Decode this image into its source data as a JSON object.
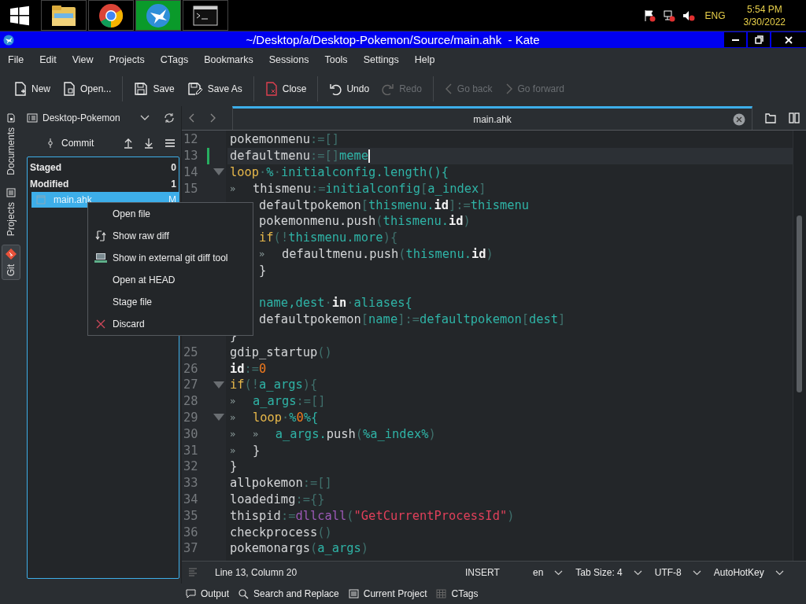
{
  "taskbar": {
    "apps": [
      {
        "kind": "explorer",
        "selected": false
      },
      {
        "kind": "chrome",
        "selected": false
      },
      {
        "kind": "kate",
        "selected": true
      },
      {
        "kind": "terminal",
        "selected": false
      }
    ],
    "tray": {
      "language": "ENG",
      "time": "5:54 PM",
      "date": "3/30/2022"
    }
  },
  "window": {
    "title": "~/Desktop/a/Desktop-Pokemon/Source/main.ahk  - Kate"
  },
  "menu": [
    "File",
    "Edit",
    "View",
    "Projects",
    "CTags",
    "Bookmarks",
    "Sessions",
    "Tools",
    "Settings",
    "Help"
  ],
  "toolbar": [
    {
      "label": "New",
      "kind": "new",
      "disabled": false
    },
    {
      "label": "Open...",
      "kind": "open",
      "disabled": false
    },
    {
      "label": "Save",
      "kind": "save",
      "disabled": false,
      "separator": true
    },
    {
      "label": "Save As",
      "kind": "saveas",
      "disabled": false
    },
    {
      "label": "Close",
      "kind": "close",
      "disabled": false,
      "separator": true
    },
    {
      "label": "Undo",
      "kind": "undo",
      "disabled": false,
      "separator": true
    },
    {
      "label": "Redo",
      "kind": "redo",
      "disabled": true
    },
    {
      "label": "Go back",
      "kind": "back",
      "disabled": true,
      "separator": true
    },
    {
      "label": "Go forward",
      "kind": "forward",
      "disabled": true
    }
  ],
  "side_tabs": [
    {
      "label": "Documents",
      "kind": "documents",
      "selected": false
    },
    {
      "label": "Projects",
      "kind": "projects",
      "selected": false
    },
    {
      "label": "Git",
      "kind": "git",
      "selected": true
    }
  ],
  "git_panel": {
    "project": "Desktop-Pokemon",
    "commit": "Commit",
    "sections": [
      {
        "label": "Staged",
        "count": "0"
      },
      {
        "label": "Modified",
        "count": "1",
        "files": [
          {
            "name": "main.ahk",
            "status": "M",
            "selected": true
          }
        ]
      }
    ]
  },
  "editor": {
    "tabs": [
      {
        "label": "main.ahk",
        "selected": true
      }
    ],
    "lines": [
      {
        "number": "12",
        "tokens": [
          {
            "kind": "plain",
            "text": "pokemonmenu"
          },
          {
            "kind": "op",
            "text": ":=[]"
          }
        ]
      },
      {
        "number": "13",
        "current": true,
        "modified": true,
        "cursor": true,
        "tokens": [
          {
            "kind": "plain",
            "text": "defaultmenu"
          },
          {
            "kind": "op",
            "text": ":=[]"
          },
          {
            "kind": "var",
            "text": "meme"
          }
        ]
      },
      {
        "number": "14",
        "fold": true,
        "tokens": [
          {
            "kind": "keyword",
            "text": "loop"
          },
          {
            "kind": "op",
            "text": "·"
          },
          {
            "kind": "var",
            "text": "%"
          },
          {
            "kind": "op",
            "text": "·"
          },
          {
            "kind": "var",
            "text": "initialconfig.length(){"
          }
        ]
      },
      {
        "number": "15",
        "marks": "»",
        "tokens": [
          {
            "kind": "plain",
            "text": "thismenu"
          },
          {
            "kind": "op",
            "text": ":="
          },
          {
            "kind": "var",
            "text": "initialconfig"
          },
          {
            "kind": "op",
            "text": "["
          },
          {
            "kind": "var",
            "text": "a_index"
          },
          {
            "kind": "op",
            "text": "]"
          }
        ]
      },
      {
        "covered": true,
        "tokens": [
          {
            "kind": "plain",
            "text": "defaultpokemon"
          },
          {
            "kind": "op",
            "text": "["
          },
          {
            "kind": "var",
            "text": "thismenu."
          },
          {
            "kind": "bold",
            "text": "id"
          },
          {
            "kind": "op",
            "text": "]:="
          },
          {
            "kind": "var",
            "text": "thismenu"
          }
        ]
      },
      {
        "covered": true,
        "tokens": [
          {
            "kind": "plain",
            "text": "pokemonmenu.push"
          },
          {
            "kind": "op",
            "text": "("
          },
          {
            "kind": "var",
            "text": "thismenu."
          },
          {
            "kind": "bold",
            "text": "id"
          },
          {
            "kind": "op",
            "text": ")"
          }
        ]
      },
      {
        "covered": true,
        "tokens": [
          {
            "kind": "keyword",
            "text": "if"
          },
          {
            "kind": "op",
            "text": "(!"
          },
          {
            "kind": "var",
            "text": "thismenu.more"
          },
          {
            "kind": "op",
            "text": "){"
          }
        ]
      },
      {
        "covered": true,
        "marks": "»",
        "tokens": [
          {
            "kind": "plain",
            "text": "defaultmenu.push"
          },
          {
            "kind": "op",
            "text": "("
          },
          {
            "kind": "var",
            "text": "thismenu."
          },
          {
            "kind": "bold",
            "text": "id"
          },
          {
            "kind": "op",
            "text": ")"
          }
        ]
      },
      {
        "covered": true,
        "tokens": [
          {
            "kind": "plain",
            "text": "}"
          }
        ]
      },
      {
        "covered": true
      },
      {
        "covered": true,
        "tokens": [
          {
            "kind": "var",
            "text": "name,dest"
          },
          {
            "kind": "op",
            "text": "·"
          },
          {
            "kind": "bold",
            "text": "in"
          },
          {
            "kind": "op",
            "text": "·"
          },
          {
            "kind": "var",
            "text": "aliases{"
          }
        ]
      },
      {
        "covered": true,
        "tokens": [
          {
            "kind": "plain",
            "text": "defaultpokemon"
          },
          {
            "kind": "op",
            "text": "["
          },
          {
            "kind": "var",
            "text": "name"
          },
          {
            "kind": "op",
            "text": "]:="
          },
          {
            "kind": "var",
            "text": "defaultpokemon"
          },
          {
            "kind": "op",
            "text": "["
          },
          {
            "kind": "var",
            "text": "dest"
          },
          {
            "kind": "op",
            "text": "]"
          }
        ]
      },
      {
        "tokens": [
          {
            "kind": "plain",
            "text": "}"
          }
        ]
      },
      {
        "number": "25",
        "tokens": [
          {
            "kind": "plain",
            "text": "gdip_startup"
          },
          {
            "kind": "op",
            "text": "()"
          }
        ]
      },
      {
        "number": "26",
        "tokens": [
          {
            "kind": "bold",
            "text": "id"
          },
          {
            "kind": "op",
            "text": ":="
          },
          {
            "kind": "number",
            "text": "0"
          }
        ]
      },
      {
        "number": "27",
        "fold": true,
        "tokens": [
          {
            "kind": "keyword",
            "text": "if"
          },
          {
            "kind": "op",
            "text": "(!"
          },
          {
            "kind": "var",
            "text": "a_args"
          },
          {
            "kind": "op",
            "text": "){"
          }
        ]
      },
      {
        "number": "28",
        "marks": "»",
        "tokens": [
          {
            "kind": "var",
            "text": "a_args"
          },
          {
            "kind": "op",
            "text": ":=[]"
          }
        ]
      },
      {
        "number": "29",
        "fold": true,
        "marks": "»",
        "tokens": [
          {
            "kind": "keyword",
            "text": "loop"
          },
          {
            "kind": "op",
            "text": "·"
          },
          {
            "kind": "var",
            "text": "%"
          },
          {
            "kind": "number",
            "text": "0"
          },
          {
            "kind": "var",
            "text": "%{"
          }
        ]
      },
      {
        "number": "30",
        "marks": "»»",
        "tokens": [
          {
            "kind": "var",
            "text": "a_args."
          },
          {
            "kind": "plain",
            "text": "push"
          },
          {
            "kind": "op",
            "text": "("
          },
          {
            "kind": "var",
            "text": "%a_index%"
          },
          {
            "kind": "op",
            "text": ")"
          }
        ]
      },
      {
        "number": "31",
        "marks": "»",
        "tokens": [
          {
            "kind": "plain",
            "text": "}"
          }
        ]
      },
      {
        "number": "32",
        "tokens": [
          {
            "kind": "plain",
            "text": "}"
          }
        ]
      },
      {
        "number": "33",
        "tokens": [
          {
            "kind": "plain",
            "text": "allpokemon"
          },
          {
            "kind": "op",
            "text": ":=[]"
          }
        ]
      },
      {
        "number": "34",
        "tokens": [
          {
            "kind": "plain",
            "text": "loadedimg"
          },
          {
            "kind": "op",
            "text": ":={}"
          }
        ]
      },
      {
        "number": "35",
        "tokens": [
          {
            "kind": "plain",
            "text": "thispid"
          },
          {
            "kind": "op",
            "text": ":="
          },
          {
            "kind": "builtin",
            "text": "dllcall"
          },
          {
            "kind": "op",
            "text": "("
          },
          {
            "kind": "string",
            "text": "\"GetCurrentProcessId\""
          },
          {
            "kind": "op",
            "text": ")"
          }
        ]
      },
      {
        "number": "36",
        "tokens": [
          {
            "kind": "plain",
            "text": "checkprocess"
          },
          {
            "kind": "op",
            "text": "()"
          }
        ]
      },
      {
        "number": "37",
        "tokens": [
          {
            "kind": "plain",
            "text": "pokemonargs"
          },
          {
            "kind": "op",
            "text": "("
          },
          {
            "kind": "var",
            "text": "a_args"
          },
          {
            "kind": "op",
            "text": ")"
          }
        ]
      }
    ]
  },
  "context_menu": [
    {
      "label": "Open file",
      "kind": "none"
    },
    {
      "label": "Show raw diff",
      "kind": "diff"
    },
    {
      "label": "Show in external git diff tool",
      "kind": "tool"
    },
    {
      "label": "Open at HEAD",
      "kind": "none"
    },
    {
      "label": "Stage file",
      "kind": "none"
    },
    {
      "label": "Discard",
      "kind": "discard"
    }
  ],
  "status_bar": {
    "position": "Line 13, Column 20",
    "mode": "INSERT",
    "dropdowns": [
      "en",
      "Tab Size: 4",
      "UTF-8",
      "AutoHotKey"
    ]
  },
  "bottom_tabs": [
    {
      "label": "Output",
      "kind": "output"
    },
    {
      "label": "Search and Replace",
      "kind": "search"
    },
    {
      "label": "Current Project",
      "kind": "project"
    },
    {
      "label": "CTags",
      "kind": "tags"
    }
  ]
}
